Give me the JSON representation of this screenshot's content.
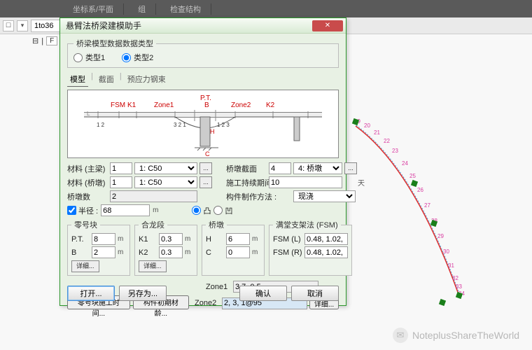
{
  "top": {
    "label1": "坐标系/平面",
    "label2": "组",
    "label3": "检查结构"
  },
  "sub": {
    "range": "1to36"
  },
  "left_mini": "F",
  "dialog": {
    "title": "悬臂法桥梁建模助手",
    "close": "✕",
    "data_type": {
      "legend": "桥梁模型数据数据类型",
      "opt1": "类型1",
      "opt2": "类型2"
    },
    "tabs": {
      "t1": "模型",
      "t2": "截面",
      "t3": "预应力钢束"
    },
    "diagram": {
      "fsm": "FSM",
      "k1": "K1",
      "zone1": "Zone1",
      "pt": "P.T.",
      "b": "B",
      "zone2": "Zone2",
      "k2": "K2",
      "h": "H",
      "c": "C",
      "L": "L",
      "ticks_left": "1 2",
      "ticks_mid_l": "3 2 1",
      "ticks_mid_r": "1 2 3",
      "ticks_right": "L"
    },
    "main": {
      "mat_girder_label": "材料 (主梁)",
      "mat_girder_num": "1",
      "mat_girder_sel": "1: C50",
      "pier_section_label": "桥墩截面",
      "pier_section_num": "4",
      "pier_section_sel": "4: 桥墩",
      "mat_pier_label": "材料 (桥墩)",
      "mat_pier_num": "1",
      "mat_pier_sel": "1: C50",
      "duration_label": "施工持续期间",
      "duration_val": "10",
      "duration_unit": "天",
      "pier_count_label": "桥墩数",
      "pier_count_val": "2",
      "method_label": "构件制作方法 :",
      "method_sel": "现浇",
      "radius_check": "半径 :",
      "radius_val": "68",
      "radius_unit": "m",
      "convex": "凸",
      "concave": "凹"
    },
    "block0": {
      "legend": "零号块",
      "pt_label": "P.T.",
      "pt_val": "8",
      "pt_unit": "m",
      "b_label": "B",
      "b_val": "2",
      "b_unit": "m",
      "detail": "详细..."
    },
    "closure": {
      "legend": "合龙段",
      "k1_label": "K1",
      "k1_val": "0.3",
      "k1_unit": "m",
      "k2_label": "K2",
      "k2_val": "0.3",
      "k2_unit": "m",
      "detail": "详细..."
    },
    "pier": {
      "legend": "桥墩",
      "h_label": "H",
      "h_val": "6",
      "h_unit": "m",
      "c_label": "C",
      "c_val": "0",
      "c_unit": "m"
    },
    "fsm": {
      "legend": "满堂支架法 (FSM)",
      "l_label": "FSM (L)",
      "l_val": "0.48, 1.02,",
      "r_label": "FSM (R)",
      "r_val": "0.48, 1.02,"
    },
    "zone1_label": "Zone1",
    "zone1_val": "3.7, 0.5",
    "zone2_label": "Zone2",
    "zone2_val": "2, 3, 1@95",
    "detail_btn": "详细...",
    "btn_time": "零号块施工时间...",
    "btn_age": "构件初期材龄...",
    "open": "打开...",
    "saveas": "另存为...",
    "ok": "确认",
    "cancel": "取消"
  },
  "watermark": "NoteplusShareTheWorld"
}
